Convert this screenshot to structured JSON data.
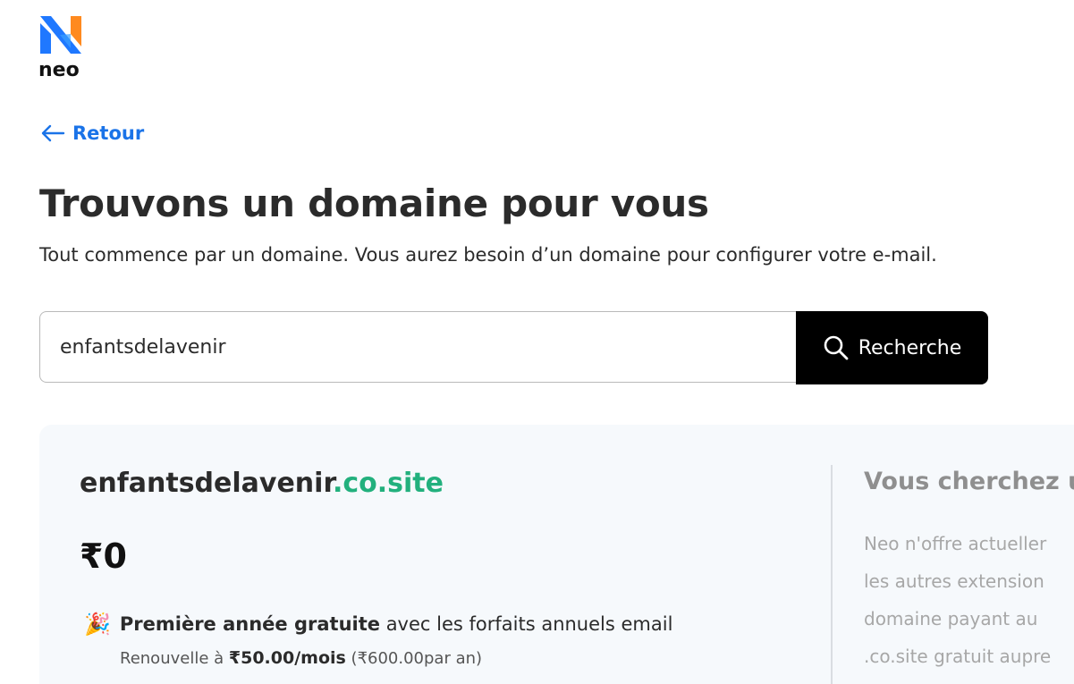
{
  "brand": {
    "name": "neo",
    "colors": {
      "blue": "#1f78ff",
      "orange": "#ff8a1f"
    }
  },
  "nav": {
    "back_label": "Retour",
    "back_icon": "arrow-left-icon"
  },
  "header": {
    "title": "Trouvons un domaine pour vous",
    "subtitle": "Tout commence par un domaine. Vous aurez besoin d’un domaine pour configurer votre e-mail."
  },
  "search": {
    "value": "enfantsdelavenir",
    "button_label": "Recherche",
    "button_icon": "search-icon"
  },
  "result": {
    "domain_name": "enfantsdelavenir",
    "domain_tld": ".co.site",
    "price": "₹0",
    "promo_icon": "party-popper-icon",
    "promo_bold": "Première année gratuite",
    "promo_rest": " avec les forfaits annuels email",
    "renew_prefix": "Renouvelle à ",
    "renew_price": "₹50.00/mois",
    "renew_suffix": " (₹600.00par an)"
  },
  "side": {
    "title": "Vous cherchez u",
    "lines": [
      "Neo n'offre actueller",
      "les autres extension",
      "domaine payant au",
      ".co.site gratuit aupre"
    ]
  }
}
